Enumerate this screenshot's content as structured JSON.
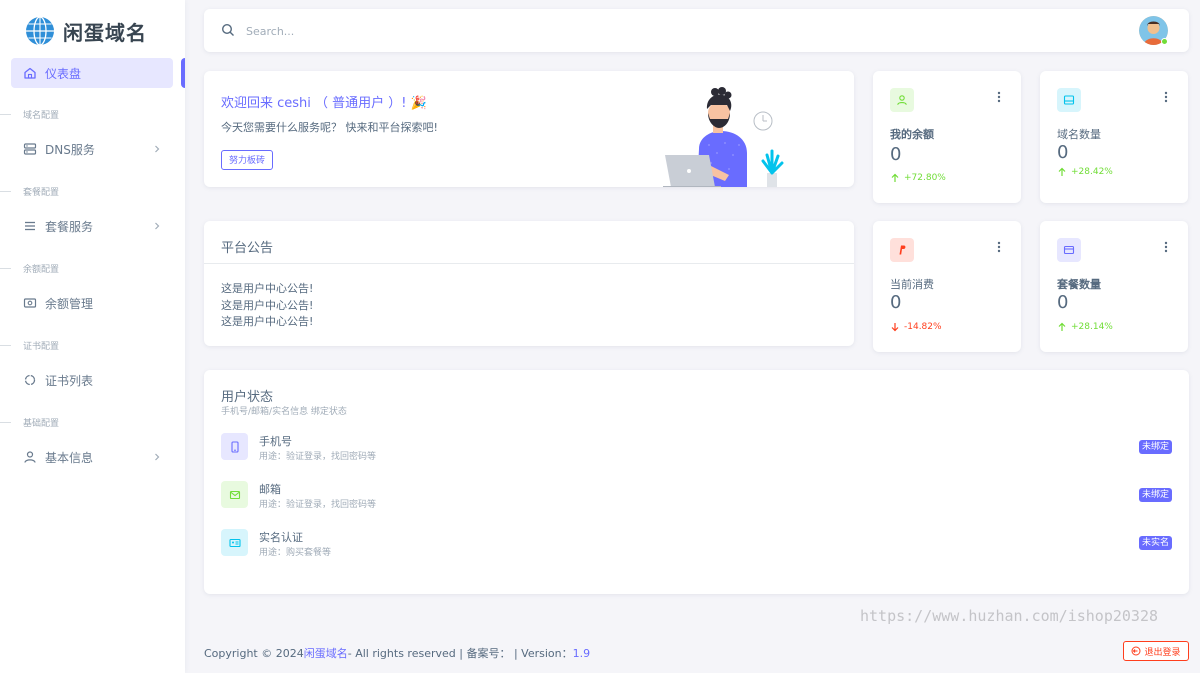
{
  "brand": {
    "name": "闲蛋域名"
  },
  "sidebar": {
    "active": {
      "label": "仪表盘",
      "icon": "home-icon"
    },
    "sections": [
      {
        "header": "域名配置",
        "item": {
          "label": "DNS服务",
          "icon": "server-icon"
        }
      },
      {
        "header": "套餐配置",
        "item": {
          "label": "套餐服务",
          "icon": "menu-lines-icon"
        }
      },
      {
        "header": "余额配置",
        "item": {
          "label": "余额管理",
          "icon": "wallet-icon"
        }
      },
      {
        "header": "证书配置",
        "item": {
          "label": "证书列表",
          "icon": "certificate-icon"
        }
      },
      {
        "header": "基础配置",
        "item": {
          "label": "基本信息",
          "icon": "user-icon"
        }
      }
    ]
  },
  "search": {
    "placeholder": "Search..."
  },
  "welcome": {
    "title": "欢迎回来 ceshi （ 普通用户 ）! 🎉",
    "subtitle": "今天您需要什么服务呢？ 快来和平台探索吧!",
    "button": "努力板砖"
  },
  "notice": {
    "title": "平台公告",
    "lines": [
      "这是用户中心公告!",
      "这是用户中心公告!",
      "这是用户中心公告!"
    ]
  },
  "stats": [
    {
      "label": "我的余额",
      "value": "0",
      "change": "+72.80%",
      "direction": "up",
      "icon": "user-icon",
      "color": "#71dd37",
      "bg": "#e8fadf"
    },
    {
      "label": "域名数量",
      "value": "0",
      "change": "+28.42%",
      "direction": "up",
      "icon": "drive-icon",
      "color": "#03c3ec",
      "bg": "#d7f5fc"
    },
    {
      "label": "当前消费",
      "value": "0",
      "change": "-14.82%",
      "direction": "down",
      "icon": "paypal-icon",
      "color": "#ff3e1d",
      "bg": "#ffe0db"
    },
    {
      "label": "套餐数量",
      "value": "0",
      "change": "+28.14%",
      "direction": "up",
      "icon": "wallet-icon",
      "color": "#696cff",
      "bg": "#e7e7ff"
    }
  ],
  "status": {
    "title": "用户状态",
    "subtitle": "手机号/邮箱/实名信息 绑定状态",
    "rows": [
      {
        "name": "手机号",
        "desc": "用途：验证登录，找回密码等",
        "badge": "未绑定",
        "icon": "phone-icon",
        "color": "#696cff",
        "bg": "#e7e7ff"
      },
      {
        "name": "邮箱",
        "desc": "用途：验证登录，找回密码等",
        "badge": "未绑定",
        "icon": "mail-icon",
        "color": "#71dd37",
        "bg": "#e8fadf"
      },
      {
        "name": "实名认证",
        "desc": "用途：购买套餐等",
        "badge": "未实名",
        "icon": "id-card-icon",
        "color": "#03c3ec",
        "bg": "#d7f5fc"
      }
    ]
  },
  "watermark": "https://www.huzhan.com/ishop20328",
  "footer": {
    "prefix": "Copyright © 2024 ",
    "brand": "闲蛋域名",
    "middle": " - All rights reserved | 备案号：  | Version：",
    "version": "1.9"
  },
  "logout": {
    "label": "退出登录"
  }
}
